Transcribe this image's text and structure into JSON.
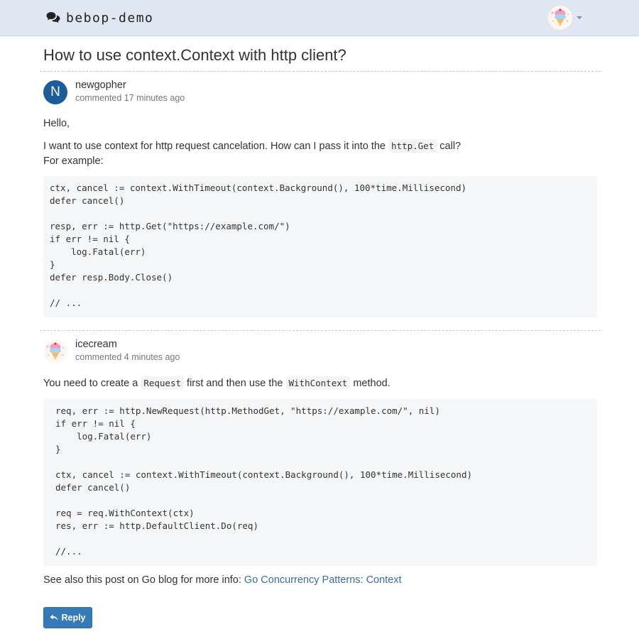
{
  "navbar": {
    "brand": "bebop-demo",
    "brand_icon": "comments-icon"
  },
  "page": {
    "title": "How to use context.Context with http client?"
  },
  "comments": [
    {
      "avatar_letter": "N",
      "author": "newgopher",
      "meta": "commented 17 minutes ago",
      "greeting": "Hello,",
      "text_before": "I want to use context for http request cancelation. How can I pass it into the",
      "inline_code": "http.Get",
      "text_after": "call?",
      "line2": "For example:",
      "code": "ctx, cancel := context.WithTimeout(context.Background(), 100*time.Millisecond)\ndefer cancel()\n\nresp, err := http.Get(\"https://example.com/\")\nif err != nil {\n    log.Fatal(err)\n}\ndefer resp.Body.Close()\n\n// ..."
    },
    {
      "author": "icecream",
      "meta": "commented 4 minutes ago",
      "t1": "You need to create a",
      "code1": "Request",
      "t2": "first and then use the",
      "code2": "WithContext",
      "t3": "method.",
      "code": "req, err := http.NewRequest(http.MethodGet, \"https://example.com/\", nil)\nif err != nil {\n    log.Fatal(err)\n}\n\nctx, cancel := context.WithTimeout(context.Background(), 100*time.Millisecond)\ndefer cancel()\n\nreq = req.WithContext(ctx)\nres, err := http.DefaultClient.Do(req)\n\n//...",
      "see_also": "See also this post on Go blog for more info:",
      "link_text": "Go Concurrency Patterns: Context"
    }
  ],
  "reply_button": {
    "label": "Reply"
  },
  "colors": {
    "navbar_bg": "#dfe8f2",
    "accent": "#337ab7",
    "link": "#3d6aa6",
    "avatar_bg": "#1a5c9c"
  }
}
